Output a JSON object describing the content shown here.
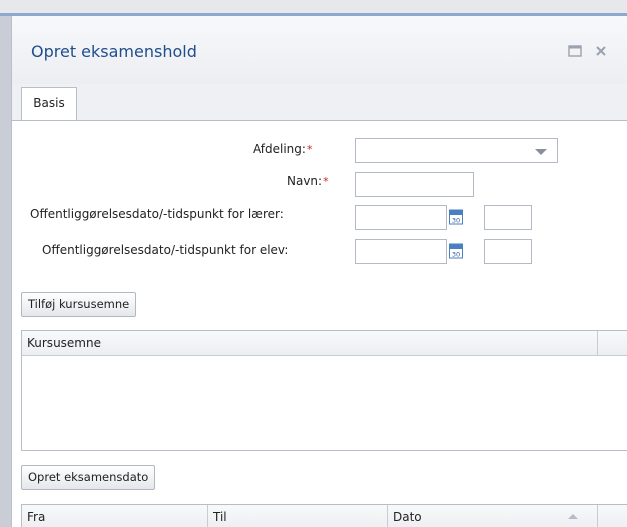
{
  "dialog": {
    "title": "Opret eksamenshold",
    "tabs": [
      {
        "label": "Basis"
      }
    ]
  },
  "form": {
    "afdeling": {
      "label": "Afdeling:",
      "required_mark": "*",
      "value": ""
    },
    "navn": {
      "label": "Navn:",
      "required_mark": "*",
      "value": ""
    },
    "publish_teacher": {
      "label": "Offentliggørelsesdato/-tidspunkt for lærer:",
      "date_value": "",
      "time_value": ""
    },
    "publish_student": {
      "label": "Offentliggørelsesdato/-tidspunkt for elev:",
      "date_value": "",
      "time_value": ""
    }
  },
  "buttons": {
    "add_course_subject": "Tilføj kursusemne",
    "create_exam_date": "Opret eksamensdato"
  },
  "course_grid": {
    "columns": [
      "Kursusemne"
    ]
  },
  "date_grid": {
    "columns": [
      "Fra",
      "Til",
      "Dato"
    ]
  },
  "icons": {
    "maximize": "maximize-icon",
    "close": "close-icon",
    "calendar": "calendar-icon",
    "dropdown": "chevron-down-icon"
  },
  "colors": {
    "title": "#1f4e8c",
    "required": "#cc2222",
    "calendar": "#4a7fc1"
  }
}
